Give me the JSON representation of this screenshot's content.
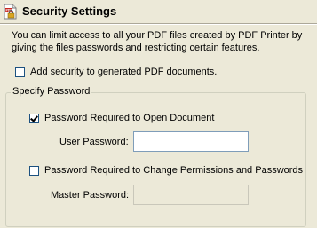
{
  "header": {
    "title": "Security Settings",
    "icon": "pdf-lock-icon"
  },
  "description": "You can limit access to all your PDF files created by PDF Printer by giving the files passwords and restricting certain features.",
  "add_security": {
    "label": "Add security to generated PDF documents.",
    "checked": false
  },
  "password_group": {
    "legend": "Specify Password",
    "open_doc": {
      "label": "Password Required to Open Document",
      "checked": true
    },
    "user_password": {
      "label": "User Password:",
      "value": ""
    },
    "change_perms": {
      "label": "Password Required to Change Permissions and Passwords",
      "checked": false
    },
    "master_password": {
      "label": "Master Password:",
      "value": "",
      "disabled": true
    }
  },
  "colors": {
    "background": "#ece9d8",
    "checkbox_border": "#1c5180",
    "input_border": "#7f9db9"
  }
}
